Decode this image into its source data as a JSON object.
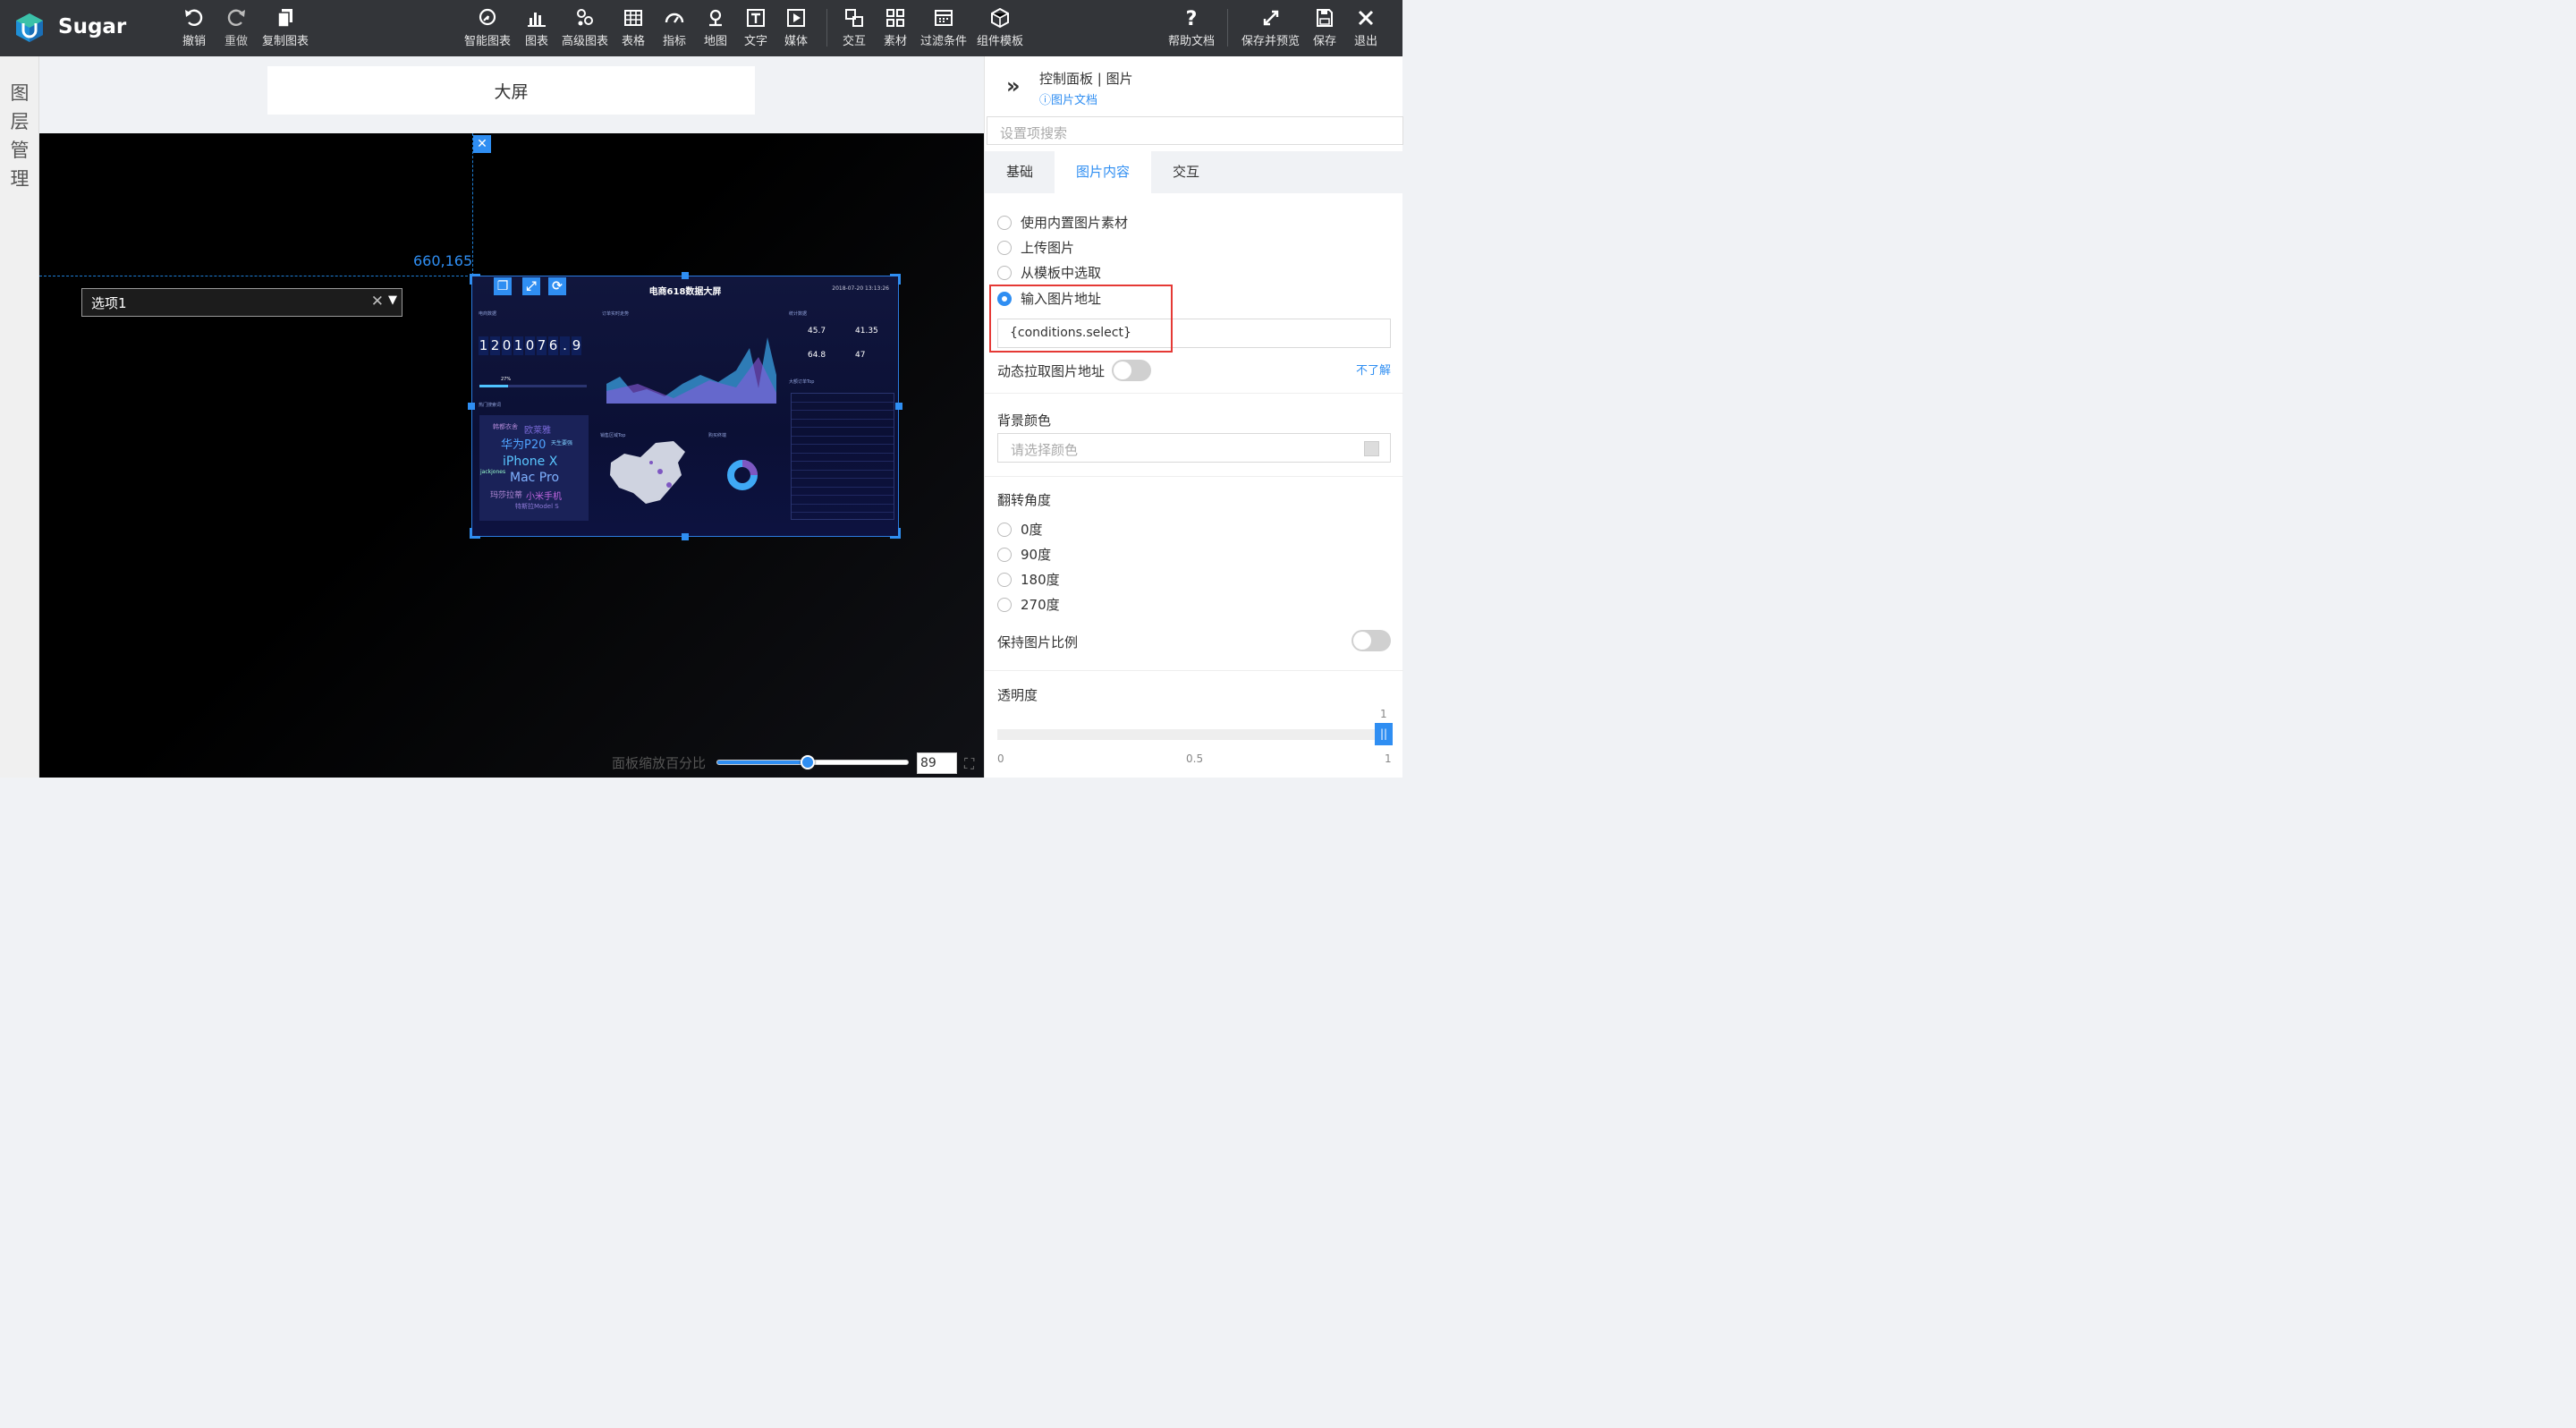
{
  "app": {
    "name": "Sugar"
  },
  "toolbar": {
    "left": [
      {
        "label": "撤销",
        "icon": "undo-icon"
      },
      {
        "label": "重做",
        "icon": "redo-icon"
      },
      {
        "label": "复制图表",
        "icon": "copy-icon"
      }
    ],
    "center": [
      {
        "label": "智能图表",
        "icon": "smart-chart-icon"
      },
      {
        "label": "图表",
        "icon": "bar-chart-icon"
      },
      {
        "label": "高级图表",
        "icon": "advanced-chart-icon"
      },
      {
        "label": "表格",
        "icon": "table-icon"
      },
      {
        "label": "指标",
        "icon": "gauge-icon"
      },
      {
        "label": "地图",
        "icon": "map-pin-icon"
      },
      {
        "label": "文字",
        "icon": "text-icon"
      },
      {
        "label": "媒体",
        "icon": "media-icon"
      }
    ],
    "center2": [
      {
        "label": "交互",
        "icon": "interaction-icon"
      },
      {
        "label": "素材",
        "icon": "material-icon"
      },
      {
        "label": "过滤条件",
        "icon": "filter-icon"
      },
      {
        "label": "组件模板",
        "icon": "component-template-icon"
      }
    ],
    "right": [
      {
        "label": "帮助文档",
        "icon": "help-icon"
      },
      {
        "label": "保存并预览",
        "icon": "expand-icon"
      },
      {
        "label": "保存",
        "icon": "save-icon"
      },
      {
        "label": "退出",
        "icon": "close-icon"
      }
    ]
  },
  "layer_panel": {
    "title": "图层管理"
  },
  "dashboard": {
    "title": "大屏"
  },
  "canvas": {
    "coordinate": "660,165",
    "select": {
      "value": "选项1"
    },
    "image": {
      "title": "电商618数据大屏",
      "date": "2018-07-20 13:13:26",
      "left_label": "电商数据",
      "digits": [
        "1",
        "2",
        "0",
        "1",
        "0",
        "7",
        "6",
        ".",
        "9"
      ],
      "progress": "27%",
      "hot_search": "热门搜索词",
      "trend_label": "订单实时走势",
      "stats_label": "统计数据",
      "kpis": [
        {
          "v": "45.7"
        },
        {
          "v": "41.35"
        },
        {
          "v": "64.8"
        },
        {
          "v": "47"
        }
      ],
      "region_label": "销售区域Top",
      "buy_label": "购买终端",
      "top_label": "大额订单Top",
      "words": [
        "韩都衣舍",
        "欧莱雅",
        "华为P20",
        "天生要强",
        "iPhone X",
        "jackjones",
        "Mac Pro",
        "玛莎拉蒂",
        "小米手机",
        "特斯拉Model S"
      ]
    }
  },
  "zoom": {
    "label": "面板缩放百分比",
    "value": "89",
    "fraction": 0.47
  },
  "panel": {
    "title": "控制面板 | 图片",
    "doc_link": "图片文档",
    "search_placeholder": "设置项搜索",
    "tabs": [
      "基础",
      "图片内容",
      "交互"
    ],
    "active_tab": "图片内容",
    "source_options": [
      "使用内置图片素材",
      "上传图片",
      "从模板中选取",
      "输入图片地址"
    ],
    "selected_source": "输入图片地址",
    "url_value": "{conditions.select}",
    "dynamic_label": "动态拉取图片地址",
    "dynamic_link": "不了解",
    "bg_label": "背景颜色",
    "bg_placeholder": "请选择颜色",
    "rotate_label": "翻转角度",
    "rotate_options": [
      "0度",
      "90度",
      "180度",
      "270度"
    ],
    "keep_ratio_label": "保持图片比例",
    "opacity_label": "透明度",
    "opacity_value": "1",
    "opacity_ticks": [
      "0",
      "0.5",
      "1"
    ]
  }
}
